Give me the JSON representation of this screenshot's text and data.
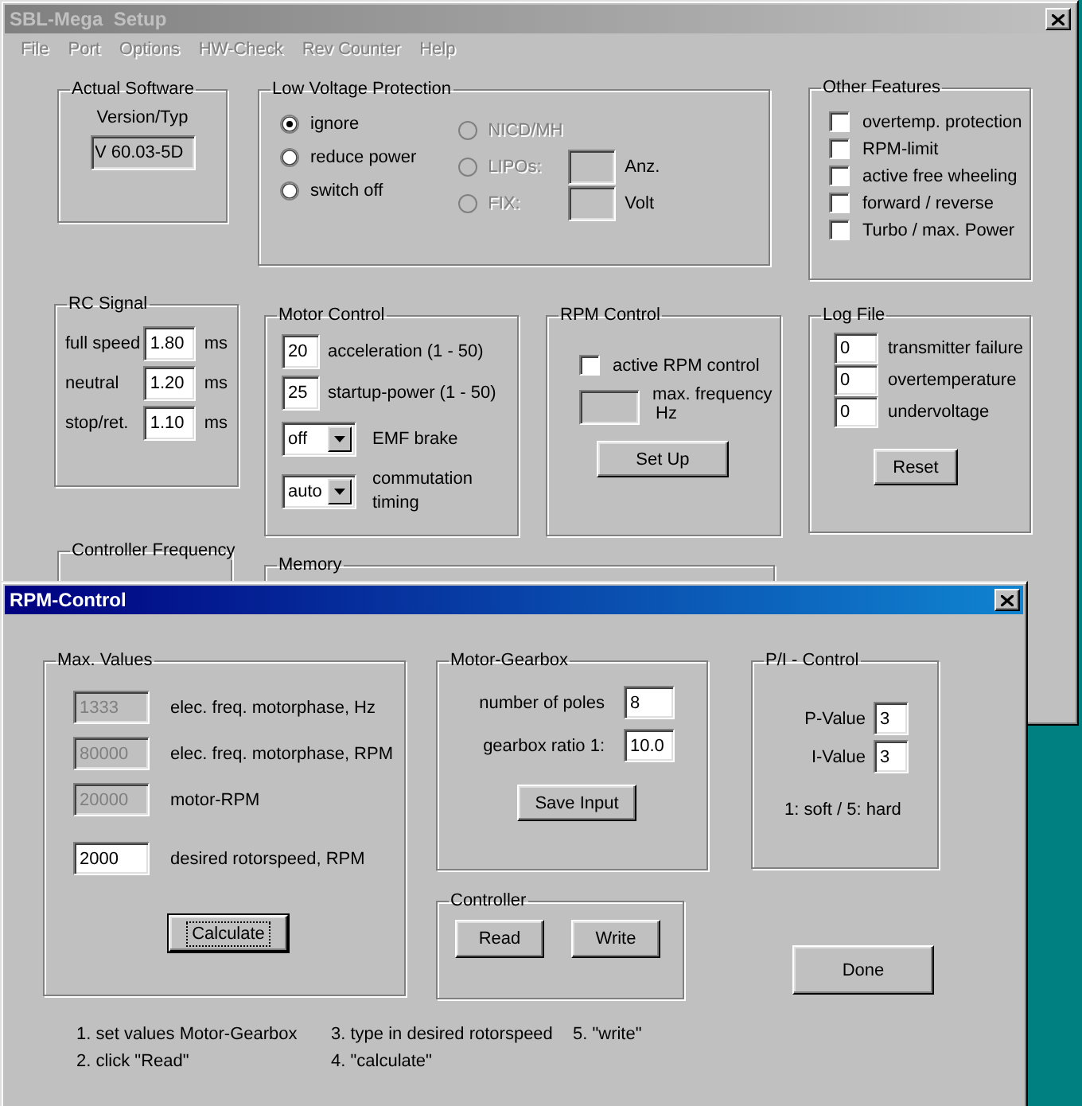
{
  "main_window": {
    "title": "SBL-Mega  Setup",
    "menu": [
      "File",
      "Port",
      "Options",
      "HW-Check",
      "Rev Counter",
      "Help"
    ],
    "actual_software": {
      "title": "Actual Software",
      "label": "Version/Typ",
      "value": "V 60.03-5D"
    },
    "low_voltage_protection": {
      "title": "Low Voltage Protection",
      "modes": [
        {
          "label": "ignore",
          "selected": true
        },
        {
          "label": "reduce power",
          "selected": false
        },
        {
          "label": "switch off",
          "selected": false
        }
      ],
      "cell_types": [
        {
          "label": "NICD/MH",
          "selected": false,
          "disabled": true
        },
        {
          "label": "LIPOs:",
          "selected": false,
          "disabled": true,
          "unit": "Anz."
        },
        {
          "label": "FIX:",
          "selected": false,
          "disabled": true,
          "unit": "Volt"
        }
      ]
    },
    "other_features": {
      "title": "Other Features",
      "options": [
        {
          "label": "overtemp. protection",
          "checked": false
        },
        {
          "label": "RPM-limit",
          "checked": false
        },
        {
          "label": "active free wheeling",
          "checked": false
        },
        {
          "label": "forward / reverse",
          "checked": false
        },
        {
          "label": "Turbo / max. Power",
          "checked": false
        }
      ]
    },
    "rc_signal": {
      "title": "RC Signal",
      "rows": [
        {
          "label": "full speed",
          "value": "1.80",
          "unit": "ms"
        },
        {
          "label": "neutral",
          "value": "1.20",
          "unit": "ms"
        },
        {
          "label": "stop/ret.",
          "value": "1.10",
          "unit": "ms"
        }
      ]
    },
    "motor_control": {
      "title": "Motor Control",
      "fields": [
        {
          "value": "20",
          "label": "acceleration (1 - 50)"
        },
        {
          "value": "25",
          "label": "startup-power (1 - 50)"
        }
      ],
      "dropdowns": [
        {
          "value": "off",
          "label": "EMF brake"
        },
        {
          "value": "auto",
          "label": "commutation timing"
        }
      ]
    },
    "rpm_control": {
      "title": "RPM Control",
      "checkbox": {
        "label": "active RPM control",
        "checked": false
      },
      "frequency_label": "max. frequency",
      "frequency_unit": "Hz",
      "button": "Set Up"
    },
    "log_file": {
      "title": "Log File",
      "rows": [
        {
          "value": "0",
          "label": "transmitter failure"
        },
        {
          "value": "0",
          "label": "overtemperature"
        },
        {
          "value": "0",
          "label": "undervoltage"
        }
      ],
      "button": "Reset"
    },
    "controller_frequency": {
      "title": "Controller Frequency"
    },
    "memory": {
      "title": "Memory"
    }
  },
  "dialog": {
    "title": "RPM-Control",
    "max_values": {
      "title": "Max. Values",
      "rows": [
        {
          "value": "1333",
          "label": "elec. freq. motorphase, Hz",
          "disabled": true
        },
        {
          "value": "80000",
          "label": "elec. freq. motorphase, RPM",
          "disabled": true
        },
        {
          "value": "20000",
          "label": "motor-RPM",
          "disabled": true
        },
        {
          "value": "2000",
          "label": "desired rotorspeed, RPM",
          "disabled": false
        }
      ],
      "button": "Calculate"
    },
    "motor_gearbox": {
      "title": "Motor-Gearbox",
      "rows": [
        {
          "label": "number of poles",
          "value": "8"
        },
        {
          "label": "gearbox ratio 1:",
          "value": "10.0"
        }
      ],
      "button": "Save Input"
    },
    "pi_control": {
      "title": "P/I - Control",
      "rows": [
        {
          "label": "P-Value",
          "value": "3"
        },
        {
          "label": "I-Value",
          "value": "3"
        }
      ],
      "note": "1: soft / 5: hard"
    },
    "controller": {
      "title": "Controller",
      "buttons": [
        "Read",
        "Write"
      ]
    },
    "done_button": "Done",
    "instructions": [
      [
        "1. set values Motor-Gearbox",
        "2. click \"Read\""
      ],
      [
        "3. type in desired rotorspeed",
        "4. \"calculate\""
      ],
      [
        "5. \"write\""
      ]
    ]
  }
}
